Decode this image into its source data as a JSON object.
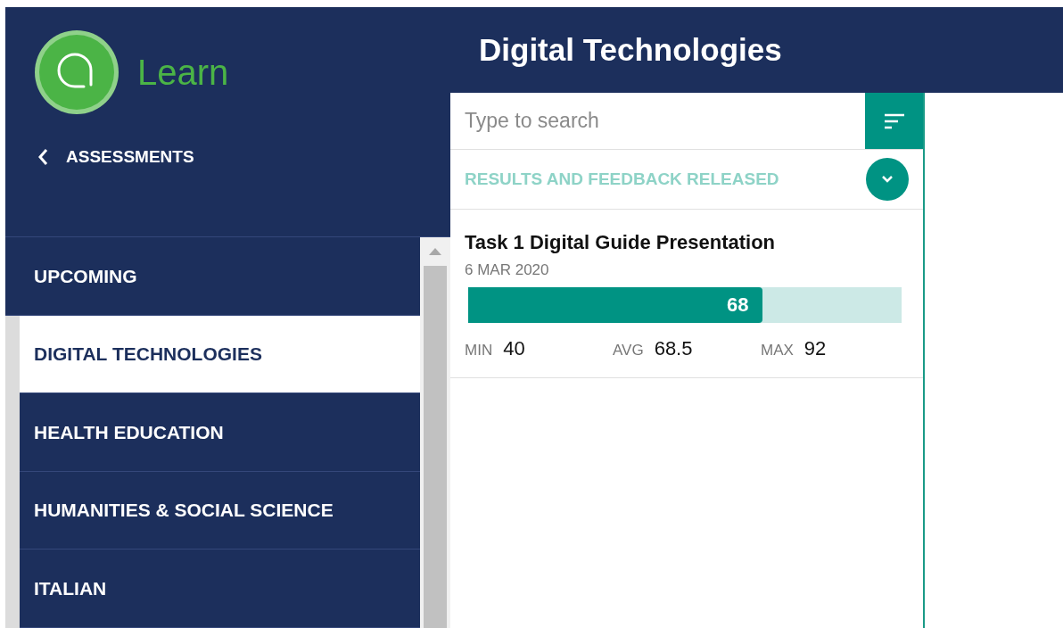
{
  "brand": {
    "name": "Learn"
  },
  "back_link": {
    "label": "ASSESSMENTS"
  },
  "nav": [
    {
      "label": "UPCOMING",
      "selected": false
    },
    {
      "label": "DIGITAL TECHNOLOGIES",
      "selected": true
    },
    {
      "label": "HEALTH EDUCATION",
      "selected": false
    },
    {
      "label": "HUMANITIES & SOCIAL SCIENCE",
      "selected": false
    },
    {
      "label": "ITALIAN",
      "selected": false
    }
  ],
  "header": {
    "title": "Digital Technologies"
  },
  "search": {
    "placeholder": "Type to search"
  },
  "section": {
    "title": "RESULTS AND FEEDBACK RELEASED",
    "expanded": true
  },
  "tasks": [
    {
      "title": "Task 1 Digital Guide Presentation",
      "date": "6 MAR 2020",
      "score": "68",
      "level": 0.68,
      "stats": [
        {
          "label": "MIN",
          "value": "40"
        },
        {
          "label": "AVG",
          "value": "68.5"
        },
        {
          "label": "MAX",
          "value": "92"
        }
      ]
    }
  ]
}
